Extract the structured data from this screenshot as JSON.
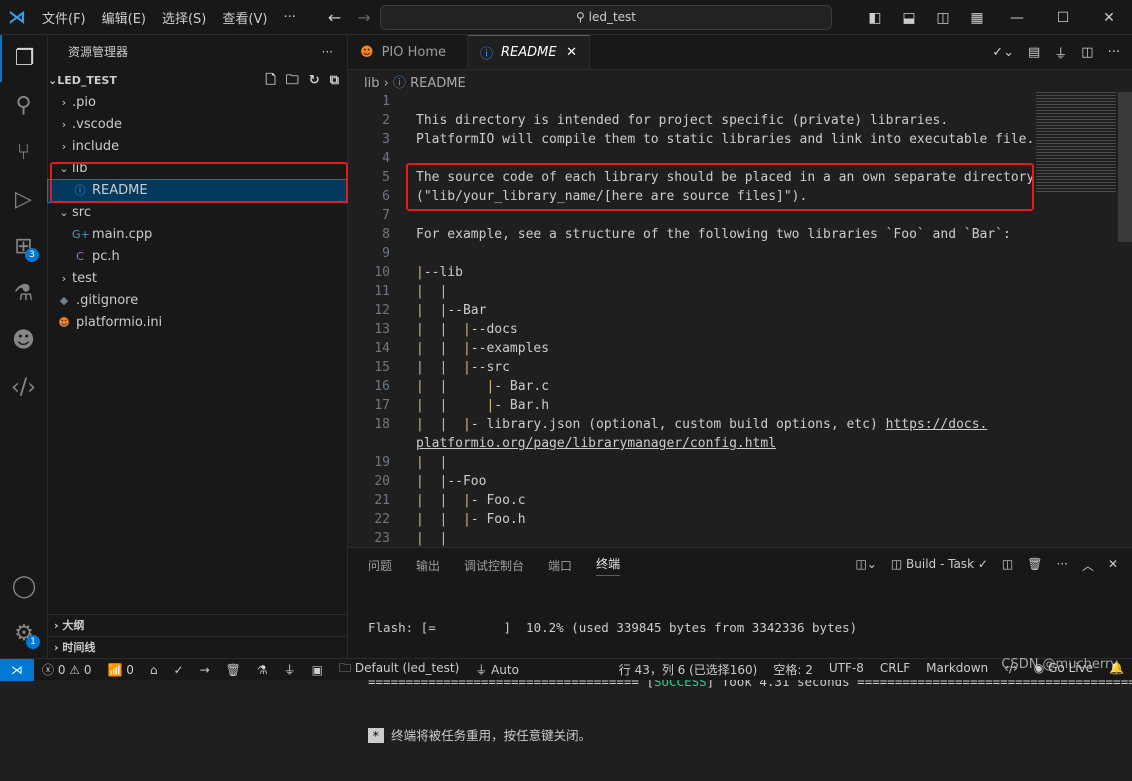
{
  "titlebar": {
    "menus": [
      "文件(F)",
      "编辑(E)",
      "选择(S)",
      "查看(V)",
      "···"
    ],
    "search": "led_test"
  },
  "activity": {
    "extensions_badge": "3",
    "settings_badge": "1"
  },
  "sidebar": {
    "title": "资源管理器",
    "more": "···",
    "project": "LED_TEST",
    "tree": [
      {
        "label": ".pio",
        "depth": 1,
        "type": "folder",
        "open": false
      },
      {
        "label": ".vscode",
        "depth": 1,
        "type": "folder",
        "open": false
      },
      {
        "label": "include",
        "depth": 1,
        "type": "folder",
        "open": false
      },
      {
        "label": "lib",
        "depth": 1,
        "type": "folder",
        "open": true
      },
      {
        "label": "README",
        "depth": 2,
        "type": "info",
        "selected": true
      },
      {
        "label": "src",
        "depth": 1,
        "type": "folder",
        "open": true
      },
      {
        "label": "main.cpp",
        "depth": 2,
        "type": "cpp"
      },
      {
        "label": "pc.h",
        "depth": 2,
        "type": "c"
      },
      {
        "label": "test",
        "depth": 1,
        "type": "folder",
        "open": false
      },
      {
        "label": ".gitignore",
        "depth": 1,
        "type": "git"
      },
      {
        "label": "platformio.ini",
        "depth": 1,
        "type": "pio"
      }
    ],
    "outline": "大纲",
    "timeline": "时间线"
  },
  "tabs": [
    {
      "label": "PIO Home",
      "active": false
    },
    {
      "label": "README",
      "active": true
    }
  ],
  "breadcrumb": [
    "lib",
    "README"
  ],
  "editor": {
    "lines": [
      {
        "n": "1",
        "t": ""
      },
      {
        "n": "2",
        "t": "This directory is intended for project specific (private) libraries."
      },
      {
        "n": "3",
        "t": "PlatformIO will compile them to static libraries and link into executable file."
      },
      {
        "n": "4",
        "t": ""
      },
      {
        "n": "5",
        "t": "The source code of each library should be placed in a an own separate directory"
      },
      {
        "n": "6",
        "t": "(\"lib/your_library_name/[here are source files]\")."
      },
      {
        "n": "7",
        "t": ""
      },
      {
        "n": "8",
        "t": "For example, see a structure of the following two libraries `Foo` and `Bar`:"
      },
      {
        "n": "9",
        "t": ""
      },
      {
        "n": "10",
        "p": "|",
        "t": "--lib"
      },
      {
        "n": "11",
        "p": "|  |",
        "t": ""
      },
      {
        "n": "12",
        "p": "|  |",
        "t": "--Bar"
      },
      {
        "n": "13",
        "p": "|  |  |",
        "t": "--docs"
      },
      {
        "n": "14",
        "p": "|  |  |",
        "t": "--examples"
      },
      {
        "n": "15",
        "p": "|  |  |",
        "t": "--src"
      },
      {
        "n": "16",
        "p": "|  |     |",
        "t": "- Bar.c"
      },
      {
        "n": "17",
        "p": "|  |     |",
        "t": "- Bar.h"
      },
      {
        "n": "18",
        "p": "|  |  |",
        "t": "- library.json (optional, custom build options, etc) ",
        "link": "https://docs."
      },
      {
        "n": "",
        "t": "",
        "link": "platformio.org/page/librarymanager/config.html"
      },
      {
        "n": "19",
        "p": "|  |",
        "t": ""
      },
      {
        "n": "20",
        "p": "|  |",
        "t": "--Foo"
      },
      {
        "n": "21",
        "p": "|  |  |",
        "t": "- Foo.c"
      },
      {
        "n": "22",
        "p": "|  |  |",
        "t": "- Foo.h"
      },
      {
        "n": "23",
        "p": "|  |",
        "t": ""
      }
    ]
  },
  "panel": {
    "tabs": [
      "问题",
      "输出",
      "调试控制台",
      "端口",
      "终端"
    ],
    "active": "终端",
    "task": "Build - Task",
    "terminal": {
      "flash": "Flash: [=         ]  10.2% (used 339845 bytes from 3342336 bytes)",
      "sep_left": "==================================== [",
      "success": "SUCCESS",
      "sep_right": "] Took 4.31 seconds =====================================",
      "reuse": "终端将被任务重用，按任意键关闭。"
    }
  },
  "status": {
    "errors": "0",
    "warnings": "0",
    "ports": "0",
    "env": "Default (led_test)",
    "auto": "Auto",
    "position": "行 43，列 6 (已选择160)",
    "spaces": "空格: 2",
    "encoding": "UTF-8",
    "eol": "CRLF",
    "language": "Markdown",
    "golive": "Go Live"
  },
  "watermark": "CSDN @mucherry",
  "colors": {
    "accent": "#0078d4",
    "highlight": "#e51a1a",
    "success": "#23d18b"
  }
}
